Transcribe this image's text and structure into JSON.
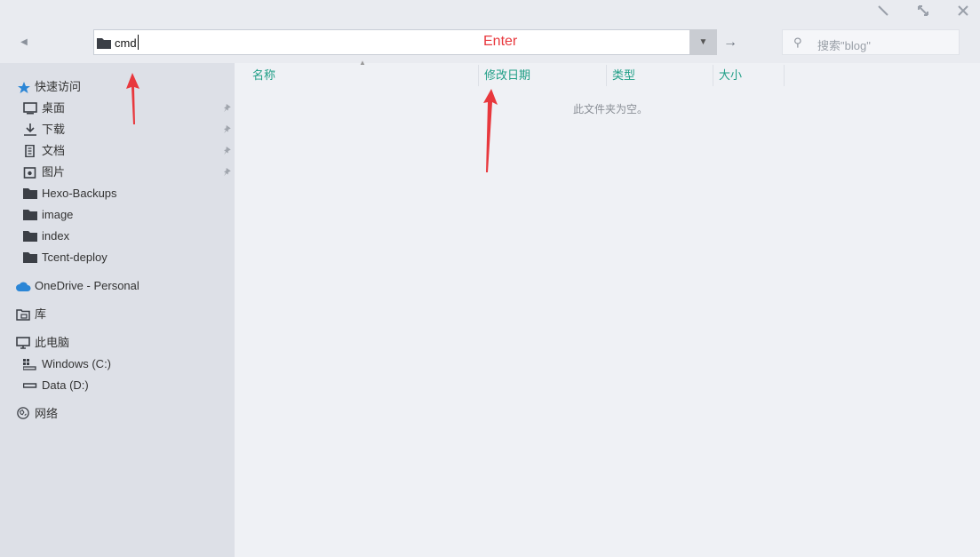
{
  "window": {
    "controls": [
      {
        "name": "minimize-icon",
        "glyph": "╲"
      },
      {
        "name": "maximize-icon",
        "glyph": "⤡"
      },
      {
        "name": "close-icon",
        "glyph": "✕"
      }
    ]
  },
  "toolbar": {
    "back_glyph": "◀",
    "address_value": "cmd",
    "dropdown_glyph": "▼",
    "go_glyph": "→",
    "search_placeholder": "搜索\"blog\"",
    "search_glyph": "⚲"
  },
  "annotation": {
    "enter_label": "Enter",
    "arrow_color": "#e8383d"
  },
  "sidebar": {
    "quick_access": "快速访问",
    "quick_items": [
      {
        "label": "桌面",
        "icon": "desktop-icon",
        "pinned": true
      },
      {
        "label": "下载",
        "icon": "download-icon",
        "pinned": true
      },
      {
        "label": "文档",
        "icon": "document-icon",
        "pinned": true
      },
      {
        "label": "图片",
        "icon": "picture-icon",
        "pinned": true
      },
      {
        "label": "Hexo-Backups",
        "icon": "folder-icon",
        "pinned": false
      },
      {
        "label": "image",
        "icon": "folder-icon",
        "pinned": false
      },
      {
        "label": "index",
        "icon": "folder-icon",
        "pinned": false
      },
      {
        "label": "Tcent-deploy",
        "icon": "folder-icon",
        "pinned": false
      }
    ],
    "onedrive": "OneDrive - Personal",
    "library": "库",
    "this_pc": "此电脑",
    "drives": [
      {
        "label": "Windows (C:)",
        "icon": "windows-drive-icon"
      },
      {
        "label": "Data (D:)",
        "icon": "drive-icon"
      }
    ],
    "network": "网络"
  },
  "content": {
    "columns": [
      "名称",
      "修改日期",
      "类型",
      "大小"
    ],
    "empty_message": "此文件夹为空。"
  },
  "colors": {
    "accent": "#1f9e86",
    "sidebar_bg": "#dde0e7",
    "content_bg": "#eff1f5"
  }
}
